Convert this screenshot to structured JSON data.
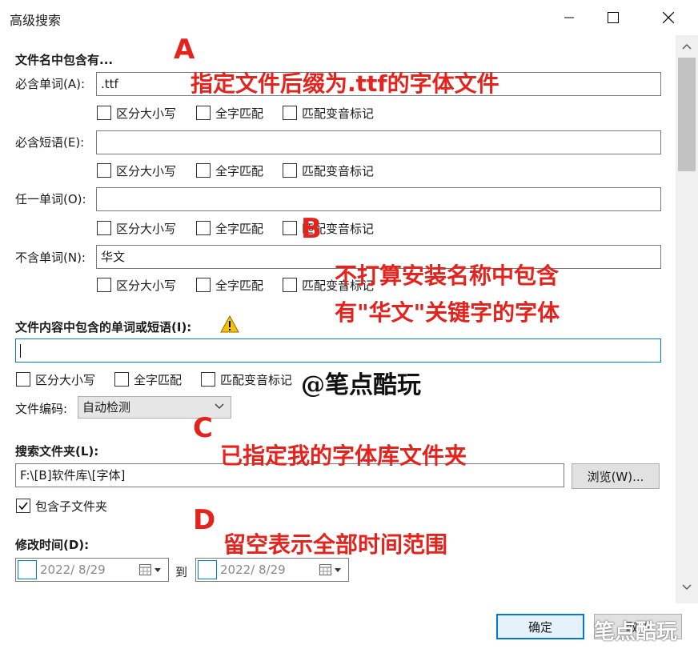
{
  "window": {
    "title": "高级搜索"
  },
  "filename_section": {
    "title": "文件名中包含有...",
    "fields": [
      {
        "label": "必含单词(A):",
        "value": ".ttf"
      },
      {
        "label": "必含短语(E):",
        "value": ""
      },
      {
        "label": "任一单词(O):",
        "value": ""
      },
      {
        "label": "不含单词(N):",
        "value": "华文"
      }
    ],
    "options": {
      "case": "区分大小写",
      "whole": "全字匹配",
      "diacritics": "匹配变音标记"
    }
  },
  "content_section": {
    "title": "文件内容中包含的单词或短语(I):",
    "value": "",
    "encoding_label": "文件编码:",
    "encoding_value": "自动检测"
  },
  "folder_section": {
    "title": "搜索文件夹(L):",
    "value": "F:\\[B]软件库\\[字体]",
    "browse_label": "浏览(W)...",
    "subfolder_label": "包含子文件夹",
    "subfolder_checked": true
  },
  "date_section": {
    "title": "修改时间(D):",
    "from": "2022/  8/29",
    "to_label": "到",
    "to": "2022/  8/29"
  },
  "footer": {
    "ok_label": "确定",
    "cancel_label": "取消"
  },
  "annotations": {
    "A": "A",
    "A_text": "指定文件后缀为.ttf的字体文件",
    "B": "B",
    "B_text_1": "不打算安装名称中包含",
    "B_text_2": "有\"华文\"关键字的字体",
    "C": "C",
    "C_text": "已指定我的字体库文件夹",
    "D": "D",
    "D_text": "留空表示全部时间范围",
    "watermark": "@笔点酷玩",
    "watermark_corner": "笔点酷玩"
  },
  "colors": {
    "accent": "#0078d7",
    "annotation": "#e5231d"
  }
}
